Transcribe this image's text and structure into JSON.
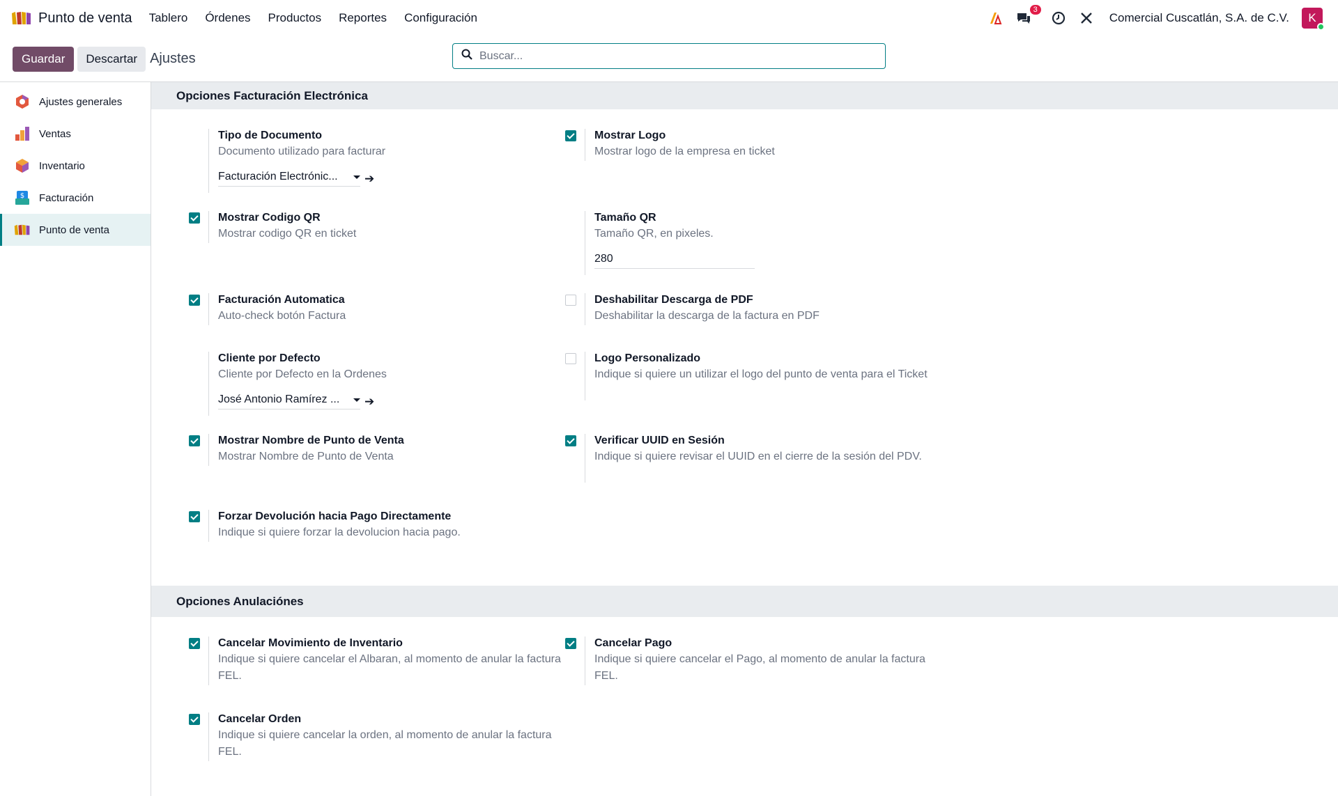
{
  "navbar": {
    "app_title": "Punto de venta",
    "menu": [
      "Tablero",
      "Órdenes",
      "Productos",
      "Reportes",
      "Configuración"
    ],
    "messages_badge": "3",
    "company": "Comercial Cuscatlán, S.A. de C.V.",
    "avatar_letter": "K"
  },
  "control": {
    "save_label": "Guardar",
    "discard_label": "Descartar",
    "breadcrumb": "Ajustes",
    "search_placeholder": "Buscar..."
  },
  "sidebar": {
    "items": [
      {
        "label": "Ajustes generales",
        "icon": "settings-icon"
      },
      {
        "label": "Ventas",
        "icon": "sales-icon"
      },
      {
        "label": "Inventario",
        "icon": "inventory-icon"
      },
      {
        "label": "Facturación",
        "icon": "invoicing-icon"
      },
      {
        "label": "Punto de venta",
        "icon": "pos-icon",
        "active": true
      }
    ]
  },
  "sections": {
    "fel_title": "Opciones Facturación Electrónica",
    "cancel_title": "Opciones Anulaciónes"
  },
  "settings": {
    "tipo_doc": {
      "title": "Tipo de Documento",
      "desc": "Documento utilizado para facturar",
      "value": "Facturación Electrónic..."
    },
    "mostrar_logo": {
      "title": "Mostrar Logo",
      "desc": "Mostrar logo de la empresa en ticket",
      "checked": true
    },
    "mostrar_qr": {
      "title": "Mostrar Codigo QR",
      "desc": "Mostrar codigo QR en ticket",
      "checked": true
    },
    "tamano_qr": {
      "title": "Tamaño QR",
      "desc": "Tamaño QR, en pixeles.",
      "value": "280"
    },
    "fact_auto": {
      "title": "Facturación Automatica",
      "desc": "Auto-check botón Factura",
      "checked": true
    },
    "deshab_pdf": {
      "title": "Deshabilitar Descarga de PDF",
      "desc": "Deshabilitar la descarga de la factura en PDF",
      "checked": false
    },
    "cliente_def": {
      "title": "Cliente por Defecto",
      "desc": "Cliente por Defecto en la Ordenes",
      "value": "José Antonio Ramírez ..."
    },
    "logo_pers": {
      "title": "Logo Personalizado",
      "desc": "Indique si quiere un utilizar el logo del punto de venta para el Ticket",
      "checked": false
    },
    "nombre_pdv": {
      "title": "Mostrar Nombre de Punto de Venta",
      "desc": "Mostrar Nombre de Punto de Venta",
      "checked": true
    },
    "verif_uuid": {
      "title": "Verificar UUID en Sesión",
      "desc": "Indique si quiere revisar el UUID en el cierre de la sesión del PDV.",
      "checked": true
    },
    "forzar_dev": {
      "title": "Forzar Devolución hacia Pago Directamente",
      "desc": "Indique si quiere forzar la devolucion hacia pago.",
      "checked": true
    },
    "cancel_mov": {
      "title": "Cancelar Movimiento de Inventario",
      "desc": "Indique si quiere cancelar el Albaran, al momento de anular la factura FEL.",
      "checked": true
    },
    "cancel_pago": {
      "title": "Cancelar Pago",
      "desc": "Indique si quiere cancelar el Pago, al momento de anular la factura FEL.",
      "checked": true
    },
    "cancel_orden": {
      "title": "Cancelar Orden",
      "desc": "Indique si quiere cancelar la orden, al momento de anular la factura FEL.",
      "checked": true
    }
  }
}
